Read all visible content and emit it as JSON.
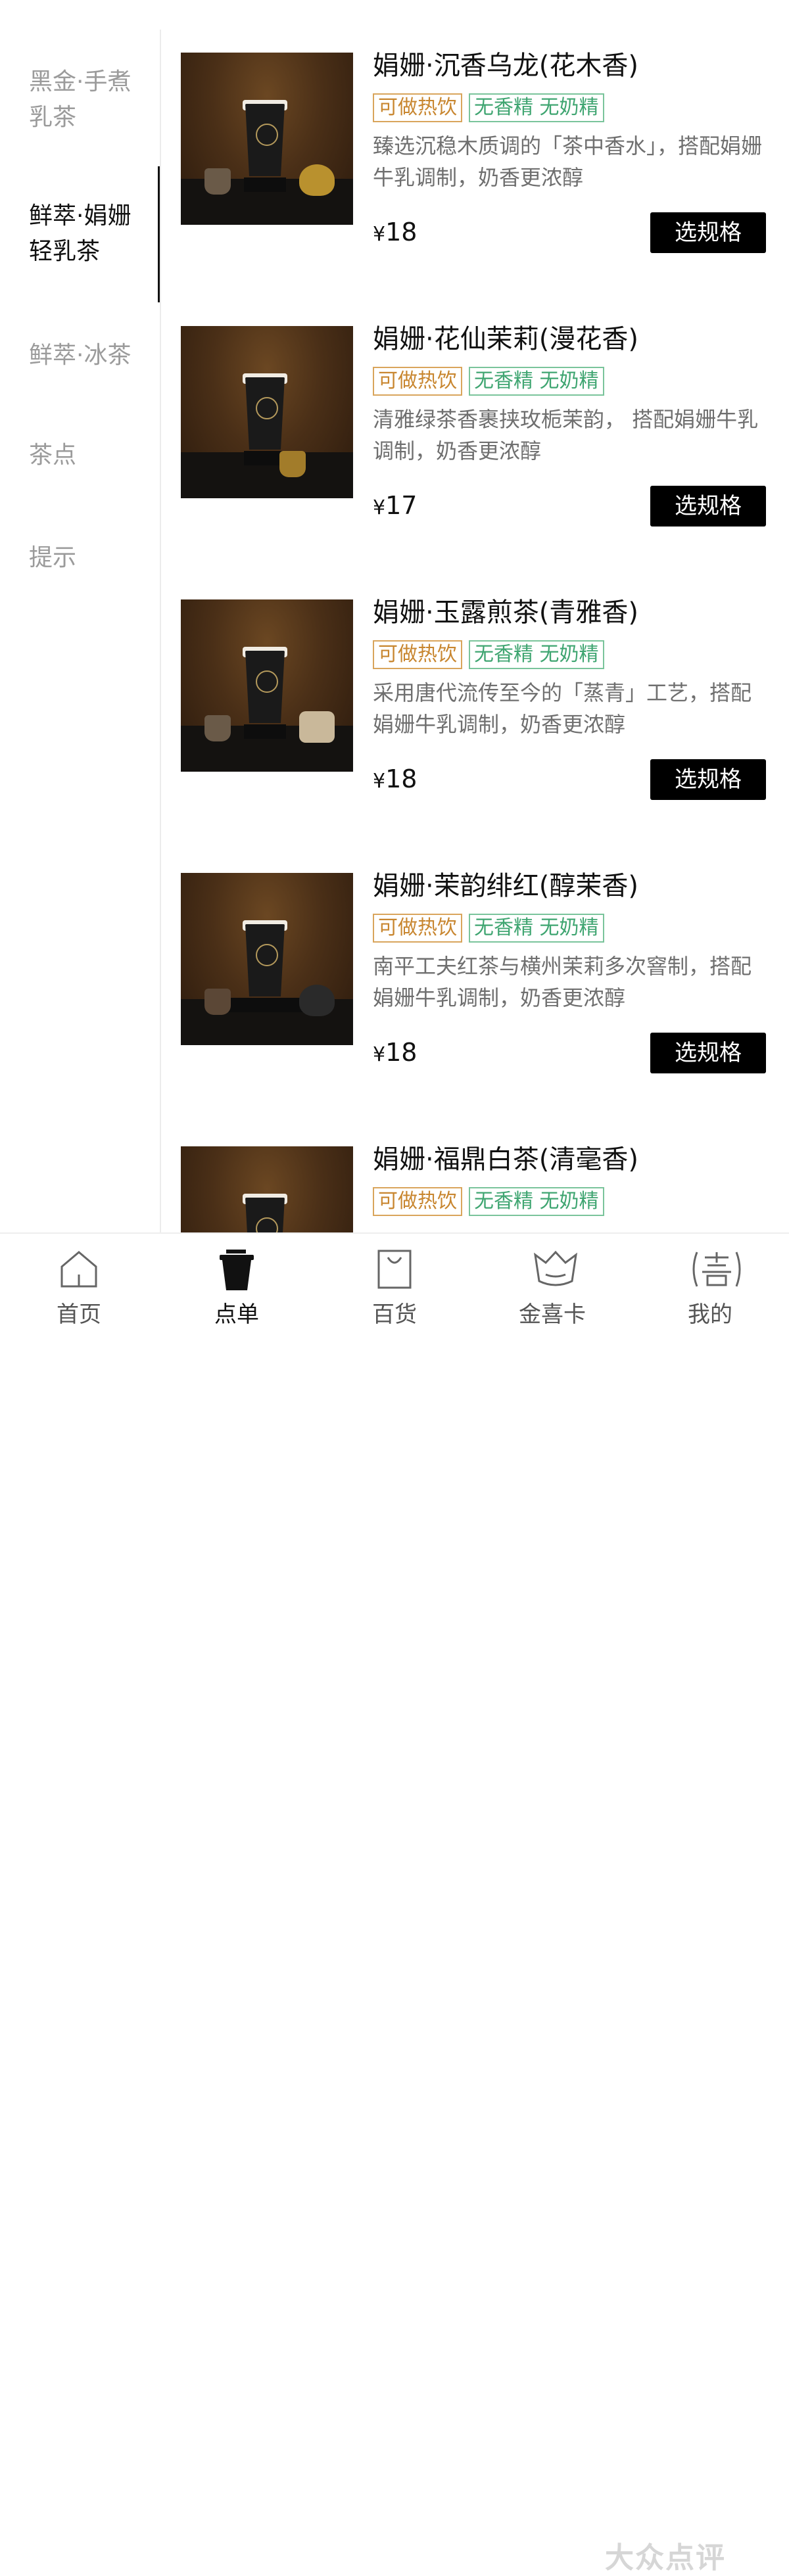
{
  "sidebar": {
    "categories": [
      {
        "label": "黑金·手煮\n乳茶"
      },
      {
        "label": "鲜萃·娟姗\n轻乳茶"
      },
      {
        "label": "鲜萃·冰茶"
      },
      {
        "label": "茶点"
      },
      {
        "label": "提示"
      }
    ],
    "active_index": 1
  },
  "products": [
    {
      "name": "娟姗·沉香乌龙(花木香)",
      "tag_hot": "可做热饮",
      "tag_free": "无香精 无奶精",
      "desc": "臻选沉稳木质调的「茶中香水」，搭配娟姗牛乳调制，奶香更浓醇",
      "currency": "¥",
      "price": "18",
      "button": "选规格"
    },
    {
      "name": "娟姗·花仙茉莉(漫花香)",
      "tag_hot": "可做热饮",
      "tag_free": "无香精 无奶精",
      "desc": "清雅绿茶香裹挟玫栀茉韵， 搭配娟姗牛乳调制，奶香更浓醇",
      "currency": "¥",
      "price": "17",
      "button": "选规格"
    },
    {
      "name": "娟姗·玉露煎茶(青雅香)",
      "tag_hot": "可做热饮",
      "tag_free": "无香精 无奶精",
      "desc": "采用唐代流传至今的「蒸青」工艺，搭配娟姗牛乳调制，奶香更浓醇",
      "currency": "¥",
      "price": "18",
      "button": "选规格"
    },
    {
      "name": "娟姗·茉韵绯红(醇茉香)",
      "tag_hot": "可做热饮",
      "tag_free": "无香精 无奶精",
      "desc": "南平工夫红茶与横州茉莉多次窨制，搭配娟姗牛乳调制，奶香更浓醇",
      "currency": "¥",
      "price": "18",
      "button": "选规格"
    },
    {
      "name": "娟姗·福鼎白茶(清毫香)",
      "tag_hot": "可做热饮",
      "tag_free": "无香精 无奶精"
    }
  ],
  "bottom_nav": {
    "items": [
      {
        "label": "首页",
        "icon": "home-icon"
      },
      {
        "label": "点单",
        "icon": "cup-icon"
      },
      {
        "label": "百货",
        "icon": "shopping-bag-icon"
      },
      {
        "label": "金喜卡",
        "icon": "crown-card-icon"
      },
      {
        "label": "我的",
        "icon": "xi-profile-icon"
      }
    ],
    "active_index": 1
  },
  "watermark": "大众点评",
  "colors": {
    "tag_hot": "#c8862f",
    "tag_free": "#3fa571",
    "button_bg": "#000000",
    "sidebar_inactive": "#9b9b9b"
  }
}
